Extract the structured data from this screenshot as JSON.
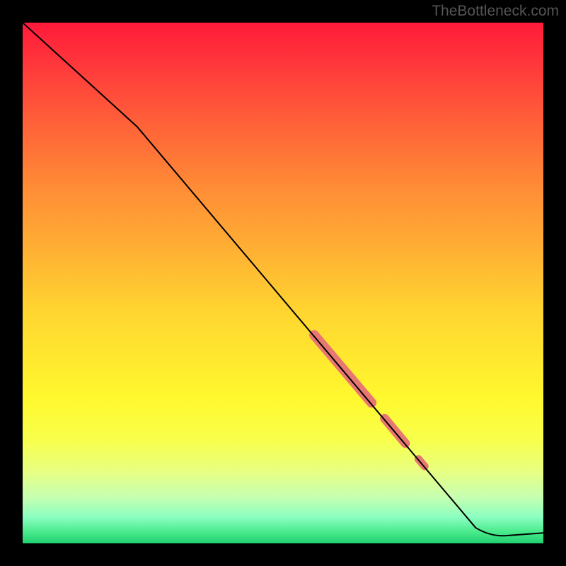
{
  "watermark": "TheBottleneck.com",
  "chart_data": {
    "type": "line",
    "title": "",
    "xlabel": "",
    "ylabel": "",
    "xlim": [
      0,
      100
    ],
    "ylim": [
      0,
      100
    ],
    "gradient_stops": [
      {
        "pos": 0,
        "color": "#ff1a3a"
      },
      {
        "pos": 10,
        "color": "#ff3f3b"
      },
      {
        "pos": 22,
        "color": "#ff6a38"
      },
      {
        "pos": 32,
        "color": "#ff8d36"
      },
      {
        "pos": 45,
        "color": "#ffb433"
      },
      {
        "pos": 55,
        "color": "#ffd430"
      },
      {
        "pos": 64,
        "color": "#ffe72f"
      },
      {
        "pos": 72,
        "color": "#fff82e"
      },
      {
        "pos": 80,
        "color": "#f8ff4a"
      },
      {
        "pos": 86,
        "color": "#e8ff80"
      },
      {
        "pos": 91,
        "color": "#c8ffb0"
      },
      {
        "pos": 95,
        "color": "#8affc0"
      },
      {
        "pos": 98,
        "color": "#45e888"
      },
      {
        "pos": 100,
        "color": "#20d070"
      }
    ],
    "series": [
      {
        "name": "curve",
        "points": [
          {
            "x": 0,
            "y": 100
          },
          {
            "x": 22,
            "y": 80
          },
          {
            "x": 87,
            "y": 3
          },
          {
            "x": 93,
            "y": 1.5
          },
          {
            "x": 100,
            "y": 2
          }
        ],
        "stroke": "#000000",
        "stroke_width": 2
      }
    ],
    "highlights": [
      {
        "name": "thick-segment-1",
        "from": {
          "x": 56,
          "y": 40
        },
        "to": {
          "x": 67,
          "y": 27
        },
        "color": "#e77770",
        "width": 14
      },
      {
        "name": "thick-segment-2",
        "from": {
          "x": 69.5,
          "y": 24
        },
        "to": {
          "x": 73.5,
          "y": 19.2
        },
        "color": "#e77770",
        "width": 13
      },
      {
        "name": "dot",
        "from": {
          "x": 76,
          "y": 16.2
        },
        "to": {
          "x": 77.2,
          "y": 14.8
        },
        "color": "#e77770",
        "width": 11
      }
    ]
  }
}
